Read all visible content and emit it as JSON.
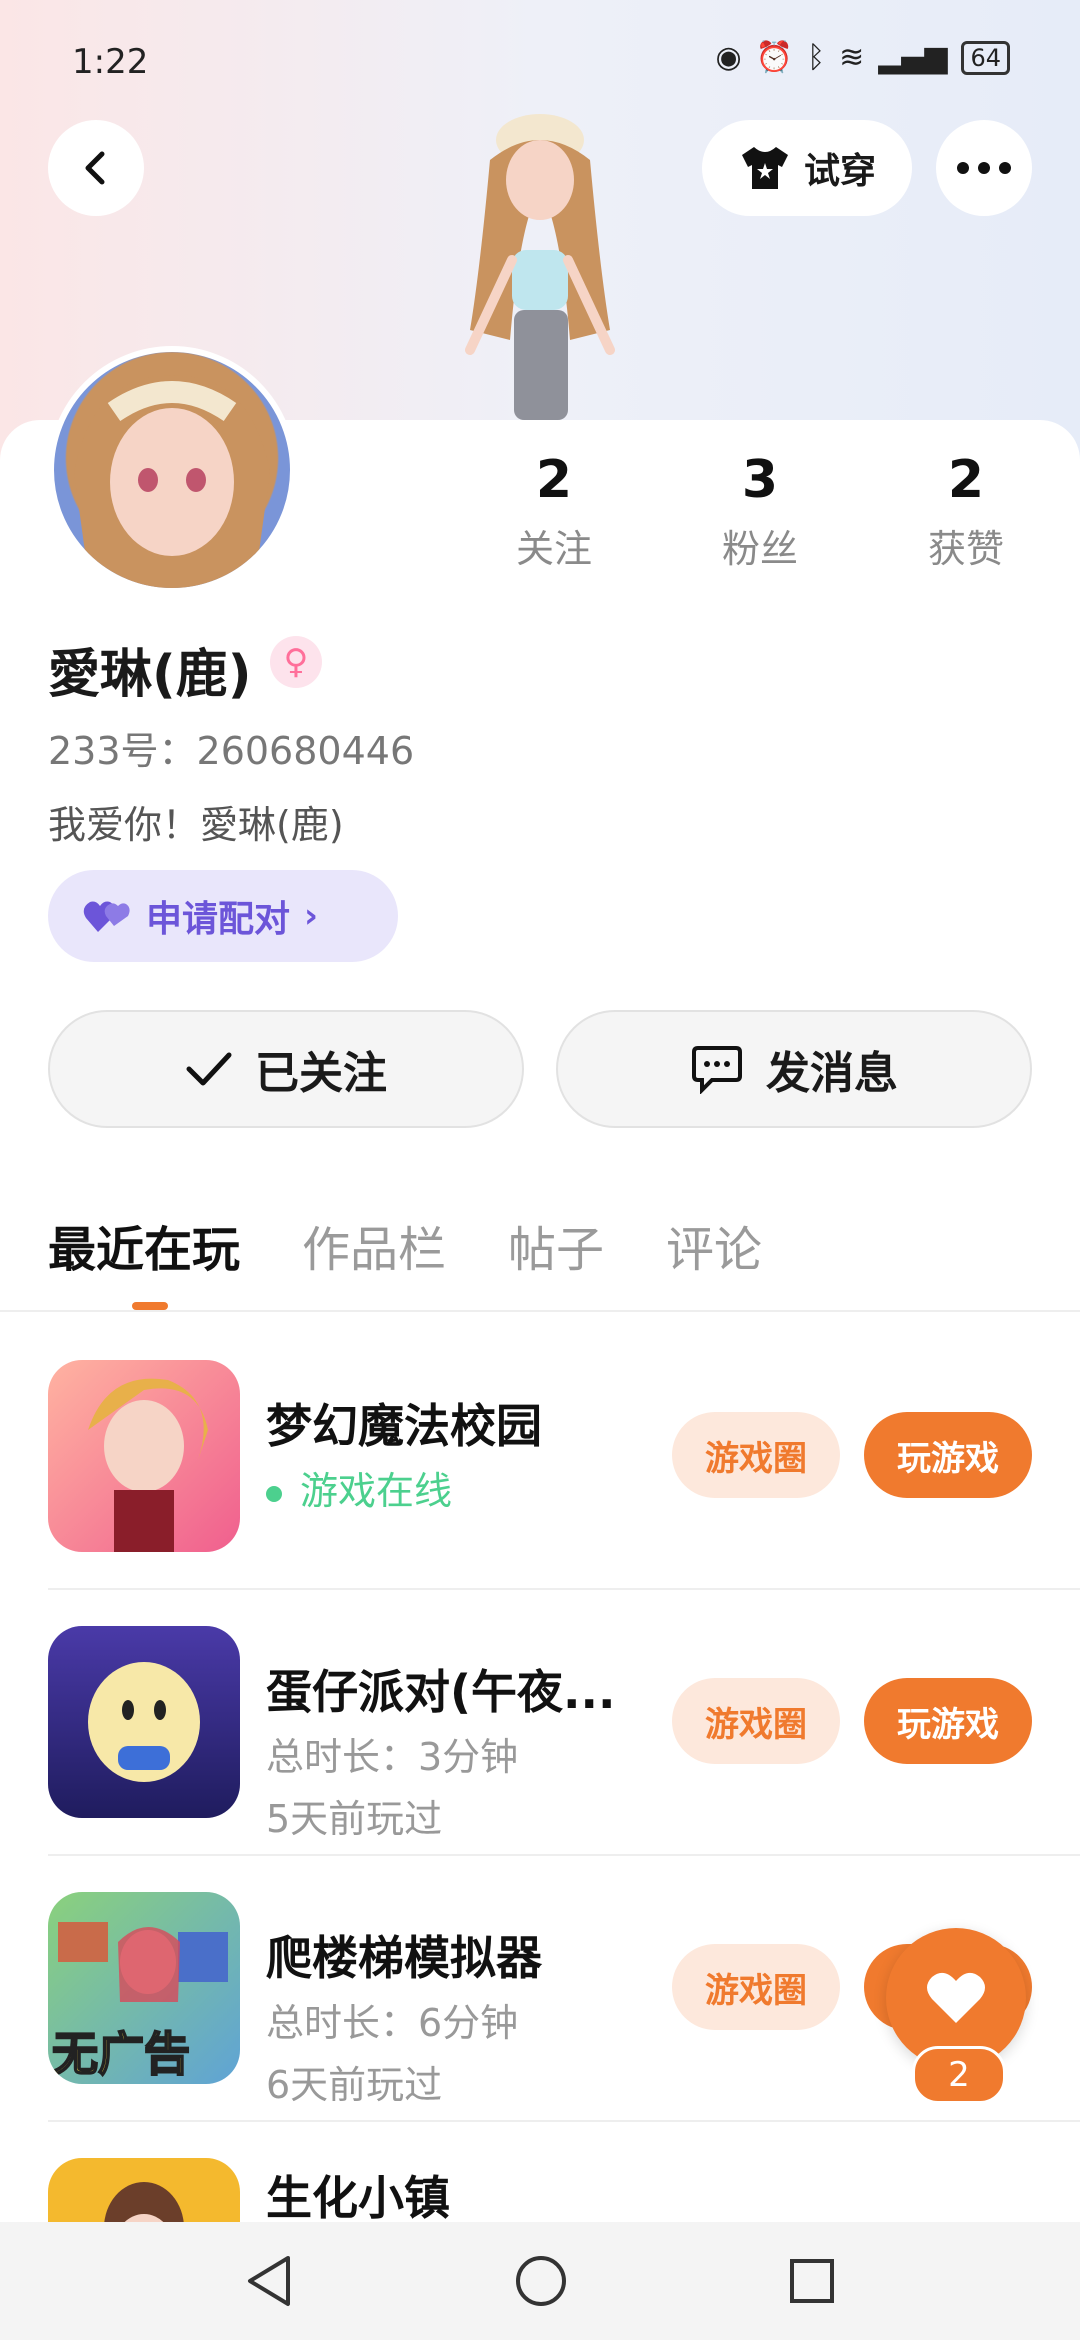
{
  "status_bar": {
    "time": "1:22",
    "battery": "64"
  },
  "header": {
    "try_on_label": "试穿"
  },
  "stats": [
    {
      "value": "2",
      "label": "关注"
    },
    {
      "value": "3",
      "label": "粉丝"
    },
    {
      "value": "2",
      "label": "获赞"
    }
  ],
  "profile": {
    "name": "愛琳(鹿)",
    "uid": "233号：260680446",
    "bio": "我爱你！愛琳(鹿)",
    "pair_label": "申请配对"
  },
  "actions": {
    "followed_label": "已关注",
    "message_label": "发消息"
  },
  "tabs": [
    "最近在玩",
    "作品栏",
    "帖子",
    "评论"
  ],
  "games": [
    {
      "title": "梦幻魔法校园",
      "online": "游戏在线",
      "circle": "游戏圈",
      "play": "玩游戏"
    },
    {
      "title": "蛋仔派对(午夜...",
      "duration": "总时长：3分钟",
      "last": "5天前玩过",
      "circle": "游戏圈",
      "play": "玩游戏"
    },
    {
      "title": "爬楼梯模拟器",
      "duration": "总时长：6分钟",
      "last": "6天前玩过",
      "circle": "游戏圈",
      "play": "玩游戏",
      "thumb_text": "无广告"
    },
    {
      "title": "生化小镇"
    }
  ],
  "fab": {
    "count": "2"
  },
  "colors": {
    "accent": "#f07a2e",
    "online": "#4cd08e",
    "pair": "#6c55d9"
  }
}
